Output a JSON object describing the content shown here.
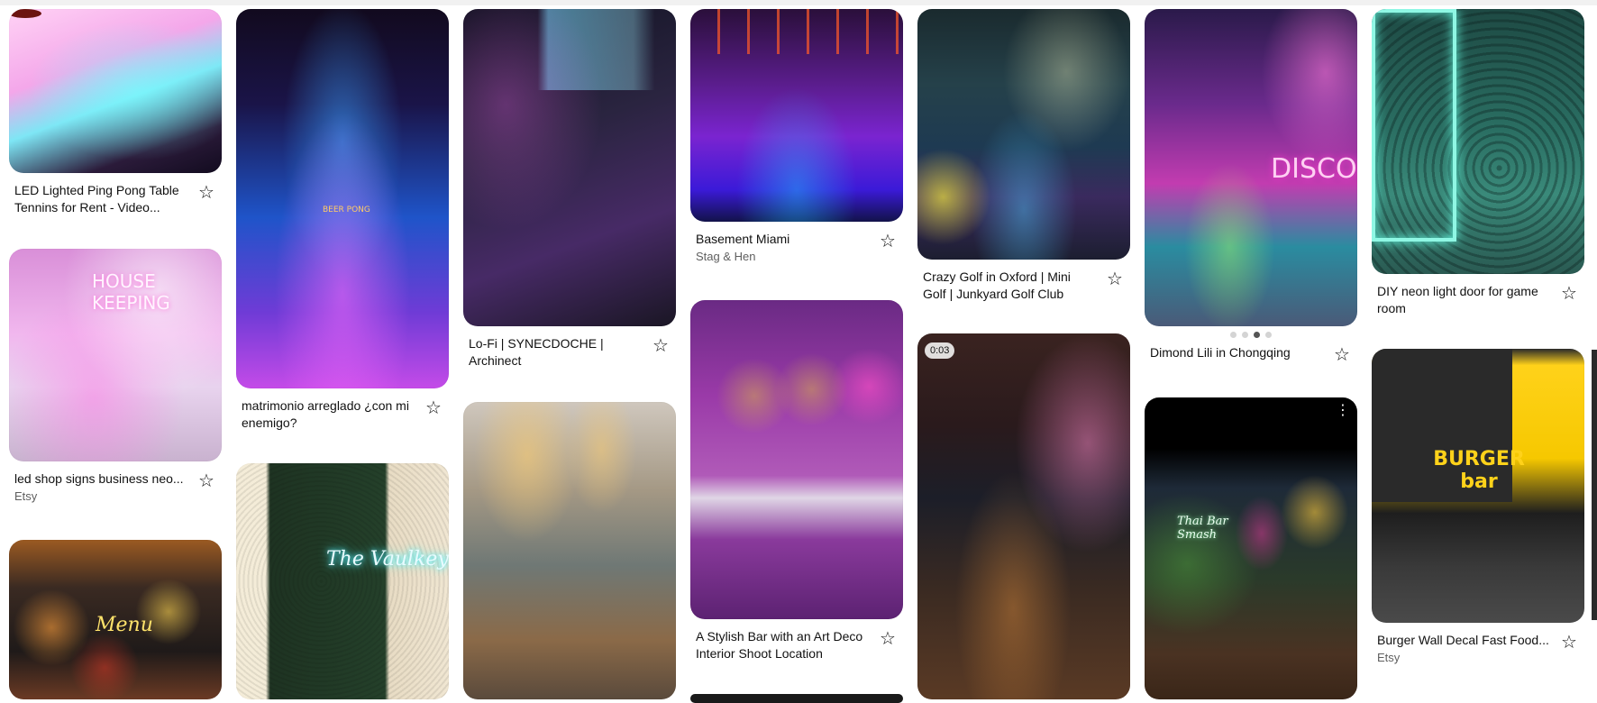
{
  "pins": [
    {
      "id": "p1",
      "title": "LED Lighted Ping Pong Table Tennins for Rent - Video...",
      "subtitle": ""
    },
    {
      "id": "p2",
      "title": "led shop signs business neo...",
      "subtitle": "Etsy",
      "image_text": "HOUSE KEEPING"
    },
    {
      "id": "p3",
      "title": "",
      "subtitle": "",
      "image_text": "Menu"
    },
    {
      "id": "p4",
      "title": "matrimonio arreglado ¿con mi enemigo?",
      "subtitle": "",
      "image_text": "BEER PONG"
    },
    {
      "id": "p5",
      "title": "",
      "subtitle": "",
      "image_text": "The Vaulkey"
    },
    {
      "id": "p6",
      "title": "Lo-Fi | SYNECDOCHE | Archinect",
      "subtitle": ""
    },
    {
      "id": "p7",
      "title": "",
      "subtitle": ""
    },
    {
      "id": "p8",
      "title": "Basement Miami",
      "subtitle": "Stag & Hen"
    },
    {
      "id": "p9",
      "title": "A Stylish Bar with an Art Deco Interior Shoot Location",
      "subtitle": ""
    },
    {
      "id": "p10",
      "title": "Crazy Golf in Oxford | Mini Golf | Junkyard Golf Club",
      "subtitle": ""
    },
    {
      "id": "p11",
      "title": "",
      "subtitle": "",
      "badge": "0:03"
    },
    {
      "id": "p12",
      "title": "Dimond Lili in Chongqing",
      "subtitle": "",
      "image_text": "DISCO",
      "carousel": {
        "count": 4,
        "active": 3
      }
    },
    {
      "id": "p13",
      "title": "",
      "subtitle": "",
      "image_text": "Thai Bar Smash"
    },
    {
      "id": "p14",
      "title": "DIY neon light door for game room",
      "subtitle": ""
    },
    {
      "id": "p15",
      "title": "Burger Wall Decal Fast Food...",
      "subtitle": "Etsy",
      "image_text": "BURGER bar"
    }
  ],
  "icons": {
    "save": "star-outline-icon",
    "more": "more-dots-icon"
  }
}
